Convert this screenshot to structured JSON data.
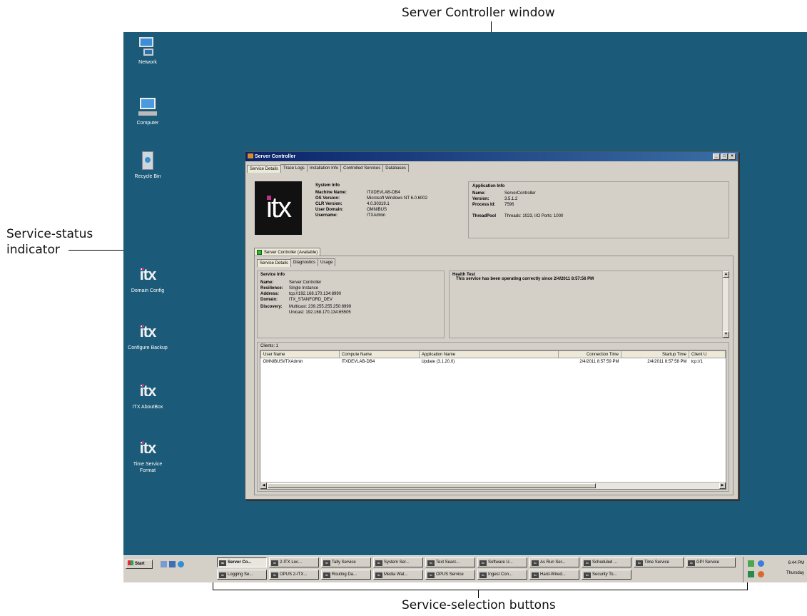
{
  "callouts": {
    "top": "Server Controller window",
    "left_line1": "Service-status",
    "left_line2": "indicator",
    "bottom": "Service-selection buttons"
  },
  "desktop": {
    "icons": [
      {
        "label": "Network",
        "icon": "network-icon"
      },
      {
        "label": "Computer",
        "icon": "computer-icon"
      },
      {
        "label": "Recycle Bin",
        "icon": "recycle-bin-icon"
      },
      {
        "label": "Domain Config",
        "icon": "itx-icon"
      },
      {
        "label": "Configure Backup",
        "icon": "itx-icon"
      },
      {
        "label": "ITX AboutBox",
        "icon": "itx-icon"
      },
      {
        "label": "Time Service Format",
        "icon": "itx-icon"
      }
    ]
  },
  "window": {
    "title": "Server Controller",
    "top_tabs": [
      "Service Details",
      "Trace Logs",
      "Installation Info",
      "Controlled Services",
      "Databases"
    ],
    "logo_text": "itx",
    "system_info": {
      "heading": "System Info",
      "rows": [
        {
          "key": "Machine Name:",
          "value": "ITXDEVLAB-DB4"
        },
        {
          "key": "OS Version:",
          "value": "Microsoft Windows NT 6.0.6002"
        },
        {
          "key": "CLR Version:",
          "value": "4.0.30319.1"
        },
        {
          "key": "User Domain:",
          "value": "OMNIBUS"
        },
        {
          "key": "Username:",
          "value": "ITXAdmin"
        }
      ]
    },
    "application_info": {
      "heading": "Application Info",
      "rows": [
        {
          "key": "Name:",
          "value": "ServerController"
        },
        {
          "key": "Version:",
          "value": "3.5.1.2"
        },
        {
          "key": "Process Id:",
          "value": "7596"
        }
      ],
      "threadpool_key": "ThreadPool",
      "threadpool_value": "Threads: 1023, I/O Ports: 1000"
    },
    "status_tab": "Server Controller (Available)",
    "status_color": "#2db82d",
    "inner_tabs": [
      "Service Details",
      "Diagnostics",
      "Usage"
    ],
    "service_info": {
      "heading": "Service Info",
      "rows": [
        {
          "key": "Name:",
          "value": "Server Controller"
        },
        {
          "key": "Resilience:",
          "value": "Single Instance"
        },
        {
          "key": "Address:",
          "value": "tcp://192.168.170.134:8990"
        },
        {
          "key": "Domain:",
          "value": "ITX_STANFORD_DEV"
        }
      ],
      "discovery_key": "Discovery:",
      "discovery_line1": "Multicast: 239.255.255.250:8999",
      "discovery_line2": "Unicast: 192.168.170.134:65505"
    },
    "health_test": {
      "heading": "Health Test",
      "message": "This service has been operating correctly since 2/4/2011 8:57:56 PM"
    },
    "clients": {
      "label": "Clients: 1",
      "columns": [
        "User Name",
        "Compute Name",
        "Application Name",
        "Connection Time",
        "Startup Time",
        "Client U"
      ],
      "rows": [
        [
          "OMNIBUS\\ITXAdmin",
          "ITXDEVLAB-DB4",
          "Update (3.1.20.0)",
          "2/4/2011 8:57:59 PM",
          "2/4/2011 8:57:58 PM",
          "tcp://1"
        ]
      ]
    }
  },
  "taskbar": {
    "start": "Start",
    "row1": [
      "Server Co...",
      "2-ITX Loc...",
      "Tally Service",
      "System Ser...",
      "Text Searc...",
      "Software U...",
      "As Run Ser...",
      "Scheduled ...",
      "Time Service",
      "GPI Service"
    ],
    "row2": [
      "Logging Se...",
      "OPUS 2-ITX...",
      "Routing Da...",
      "Media Wat...",
      "OPUS Service",
      "Ingest Con...",
      "Hard-Wired...",
      "Security To..."
    ],
    "clock": "6:44 PM",
    "day": "Thursday"
  }
}
